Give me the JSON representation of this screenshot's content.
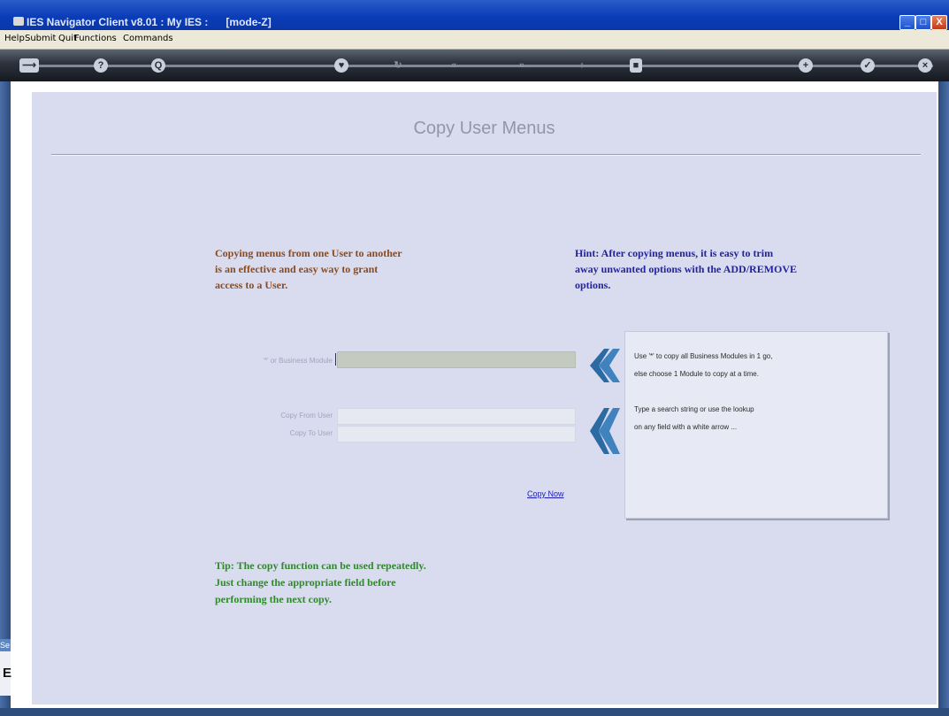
{
  "window": {
    "title": "IES Navigator Client v8.01 : My IES :      [mode-Z]",
    "buttons": {
      "minimize": "_",
      "maximize": "□",
      "close": "X"
    }
  },
  "menu": [
    "Help",
    "Submit",
    "Quit",
    "Functions",
    "Commands"
  ],
  "toolbar": {
    "icons": [
      {
        "name": "back-arrow-icon",
        "glyph": "⟶"
      },
      {
        "name": "help-icon",
        "glyph": "?"
      },
      {
        "name": "search-icon",
        "glyph": "Q"
      },
      {
        "name": "heart-icon",
        "glyph": "♥"
      },
      {
        "name": "refresh-icon",
        "glyph": "↻"
      },
      {
        "name": "rewind-icon",
        "glyph": "«"
      },
      {
        "name": "forward-icon",
        "glyph": "»"
      },
      {
        "name": "up-icon",
        "glyph": "↑"
      },
      {
        "name": "stop-icon",
        "glyph": "■"
      },
      {
        "name": "add-icon",
        "glyph": "+"
      },
      {
        "name": "confirm-icon",
        "glyph": "✓"
      },
      {
        "name": "cancel-icon",
        "glyph": "×"
      }
    ]
  },
  "page": {
    "heading": "Copy User Menus",
    "intro": [
      "Copying menus from one User to another",
      "is an effective and easy way to grant",
      "access to a User."
    ],
    "hint": [
      "Hint: After copying menus, it is easy to trim",
      "away unwanted options with the ADD/REMOVE",
      "options."
    ],
    "tip": [
      "Tip: The copy function can be used repeatedly.",
      "Just change the appropriate field before",
      "performing the next copy."
    ],
    "fields": {
      "business_module_label": "'*' or Business Module",
      "copy_from_label": "Copy From User",
      "copy_to_label": "Copy To User",
      "business_module_value": "",
      "copy_from_value": "",
      "copy_to_value": ""
    },
    "help": {
      "line1": "Use '*' to copy all Business Modules in 1 go,",
      "line2": "else choose 1 Module to copy at a time.",
      "line3": "Type a search string or use the lookup",
      "line4": "on any field with a white arrow ..."
    },
    "copy_now": "Copy Now"
  },
  "left_stub": {
    "tab": "Se",
    "letter": "E"
  }
}
